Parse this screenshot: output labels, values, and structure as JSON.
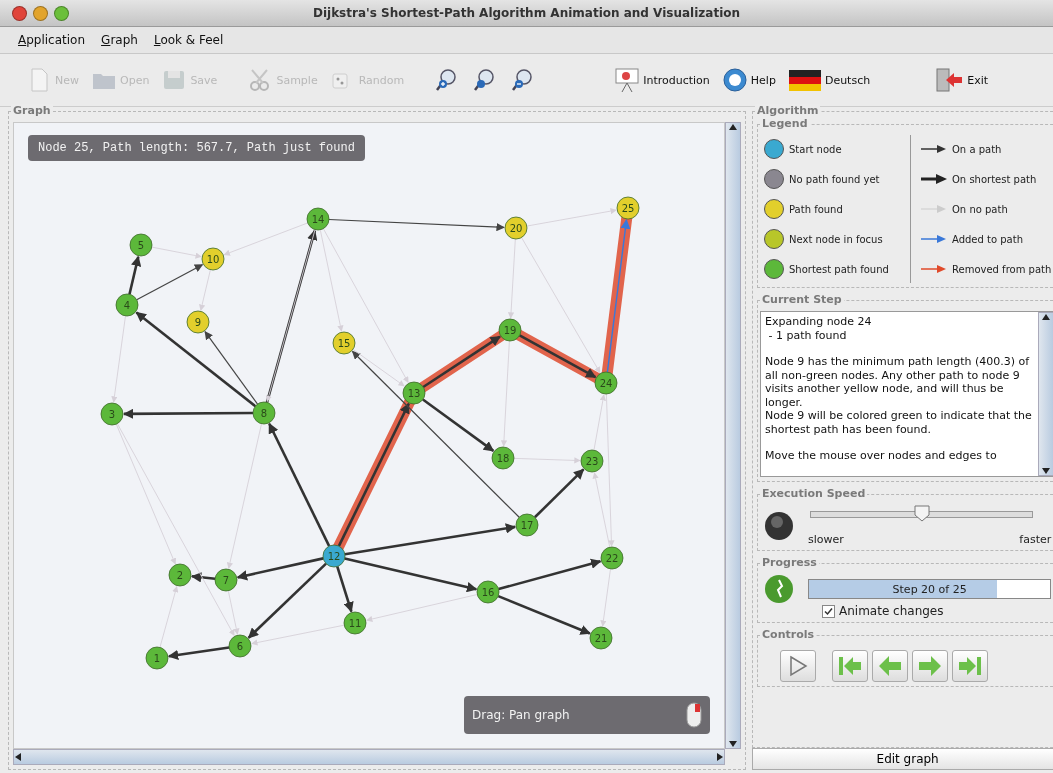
{
  "window": {
    "title": "Dijkstra's Shortest-Path Algorithm Animation and Visualization"
  },
  "menu": [
    {
      "label": "Application"
    },
    {
      "label": "Graph"
    },
    {
      "label": "Look & Feel"
    }
  ],
  "toolbar": [
    {
      "kind": "new",
      "label": "New",
      "disabled": true
    },
    {
      "kind": "open",
      "label": "Open",
      "disabled": true
    },
    {
      "kind": "save",
      "label": "Save",
      "disabled": true
    },
    {
      "kind": "sample",
      "label": "Sample",
      "disabled": true
    },
    {
      "kind": "random",
      "label": "Random",
      "disabled": true
    },
    {
      "kind": "zoom-in",
      "disabled": false
    },
    {
      "kind": "zoom-reset",
      "disabled": false
    },
    {
      "kind": "zoom-out",
      "disabled": false
    },
    {
      "kind": "introduction",
      "label": "Introduction",
      "disabled": false
    },
    {
      "kind": "help",
      "label": "Help",
      "disabled": false
    },
    {
      "kind": "language",
      "label": "Deutsch",
      "disabled": false
    },
    {
      "kind": "exit",
      "label": "Exit",
      "disabled": false
    }
  ],
  "graph": {
    "title": "Graph",
    "status": "Node 25, Path length: 567.7, Path just found",
    "hint": "Drag: Pan graph",
    "nodes": [
      {
        "label": "25",
        "kind": "path"
      },
      {
        "label": "14",
        "kind": "shortest"
      },
      {
        "label": "20",
        "kind": "path"
      },
      {
        "label": "5",
        "kind": "shortest"
      },
      {
        "label": "10",
        "kind": "path"
      },
      {
        "label": "4",
        "kind": "shortest"
      },
      {
        "label": "9",
        "kind": "path"
      },
      {
        "label": "15",
        "kind": "path"
      },
      {
        "label": "19",
        "kind": "shortest"
      },
      {
        "label": "13",
        "kind": "shortest"
      },
      {
        "label": "24",
        "kind": "shortest"
      },
      {
        "label": "3",
        "kind": "shortest"
      },
      {
        "label": "8",
        "kind": "shortest"
      },
      {
        "label": "18",
        "kind": "shortest"
      },
      {
        "label": "23",
        "kind": "shortest"
      },
      {
        "label": "17",
        "kind": "shortest"
      },
      {
        "label": "12",
        "kind": "start"
      },
      {
        "label": "22",
        "kind": "shortest"
      },
      {
        "label": "2",
        "kind": "shortest"
      },
      {
        "label": "7",
        "kind": "shortest"
      },
      {
        "label": "16",
        "kind": "shortest"
      },
      {
        "label": "11",
        "kind": "shortest"
      },
      {
        "label": "6",
        "kind": "shortest"
      },
      {
        "label": "21",
        "kind": "shortest"
      },
      {
        "label": "1",
        "kind": "shortest"
      }
    ],
    "edges": [
      {
        "kind": "shortest",
        "highlighted": true
      },
      {
        "kind": "shortest",
        "highlighted": true
      },
      {
        "kind": "shortest",
        "highlighted": true
      },
      {
        "kind": "added",
        "highlighted": true
      },
      {
        "kind": "shortest",
        "highlighted": false
      },
      {
        "kind": "shortest",
        "highlighted": false
      },
      {
        "kind": "shortest",
        "highlighted": false
      },
      {
        "kind": "shortest",
        "highlighted": false
      },
      {
        "kind": "shortest",
        "highlighted": false
      },
      {
        "kind": "shortest",
        "highlighted": false
      },
      {
        "kind": "shortest",
        "highlighted": false
      },
      {
        "kind": "shortest",
        "highlighted": false
      },
      {
        "kind": "shortest",
        "highlighted": false
      },
      {
        "kind": "shortest",
        "highlighted": false
      },
      {
        "kind": "shortest",
        "highlighted": false
      },
      {
        "kind": "shortest",
        "highlighted": false
      },
      {
        "kind": "shortest",
        "highlighted": false
      },
      {
        "kind": "shortest",
        "highlighted": false
      },
      {
        "kind": "shortest",
        "highlighted": false
      },
      {
        "kind": "shortest",
        "highlighted": false
      },
      {
        "kind": "path",
        "highlighted": false
      },
      {
        "kind": "path",
        "highlighted": false
      },
      {
        "kind": "path",
        "highlighted": false
      },
      {
        "kind": "path",
        "highlighted": false
      },
      {
        "kind": "none",
        "highlighted": false
      },
      {
        "kind": "none",
        "highlighted": false
      },
      {
        "kind": "none",
        "highlighted": false
      },
      {
        "kind": "none",
        "highlighted": false
      },
      {
        "kind": "none",
        "highlighted": false
      },
      {
        "kind": "none",
        "highlighted": false
      },
      {
        "kind": "none",
        "highlighted": false
      },
      {
        "kind": "none",
        "highlighted": false
      },
      {
        "kind": "none",
        "highlighted": false
      },
      {
        "kind": "none",
        "highlighted": false
      },
      {
        "kind": "none",
        "highlighted": false
      },
      {
        "kind": "none",
        "highlighted": false
      },
      {
        "kind": "none",
        "highlighted": false
      },
      {
        "kind": "none",
        "highlighted": false
      },
      {
        "kind": "none",
        "highlighted": false
      },
      {
        "kind": "none",
        "highlighted": false
      },
      {
        "kind": "none",
        "highlighted": false
      },
      {
        "kind": "none",
        "highlighted": false
      },
      {
        "kind": "none",
        "highlighted": false
      },
      {
        "kind": "none",
        "highlighted": false
      },
      {
        "kind": "none",
        "highlighted": false
      },
      {
        "kind": "none",
        "highlighted": false
      },
      {
        "kind": "none",
        "highlighted": false
      },
      {
        "kind": "none",
        "highlighted": false
      }
    ]
  },
  "algorithm": {
    "title": "Algorithm",
    "legend": {
      "title": "Legend",
      "nodes": [
        {
          "label": "Start node",
          "color": "#3aa9d0"
        },
        {
          "label": "No path found yet",
          "color": "#8a8790"
        },
        {
          "label": "Path found",
          "color": "#e2cf2c"
        },
        {
          "label": "Next node in focus",
          "color": "#b8c629"
        },
        {
          "label": "Shortest path found",
          "color": "#5cb83a"
        }
      ],
      "arrows": [
        {
          "label": "On a path",
          "color": "#333333",
          "kind": "thin"
        },
        {
          "label": "On shortest path",
          "color": "#222222",
          "kind": "thick"
        },
        {
          "label": "On no path",
          "color": "#cccccc",
          "kind": "faint"
        },
        {
          "label": "Added to path",
          "color": "#3a78d8",
          "kind": "thin"
        },
        {
          "label": "Removed from path",
          "color": "#e04a2a",
          "kind": "thin"
        }
      ]
    },
    "current_step": {
      "title": "Current Step",
      "paragraphs": [
        "Expanding node 24\n - 1 path found",
        "Node 9 has the minimum path length (400.3) of all non-green nodes. Any other path to node 9 visits another yellow node, and will thus be longer.\nNode 9 will be colored green to indicate that the shortest path has been found.",
        "Move the mouse over nodes and edges to"
      ]
    },
    "speed": {
      "title": "Execution Speed",
      "level": 0.5,
      "slower": "slower",
      "faster": "faster"
    },
    "progress": {
      "title": "Progress",
      "level": 0.78,
      "text": "Step 20 of 25"
    },
    "animate": {
      "label": "Animate changes",
      "checked": true
    },
    "controls": {
      "title": "Controls",
      "buttons": [
        {
          "kind": "play"
        },
        {
          "kind": "first"
        },
        {
          "kind": "previous"
        },
        {
          "kind": "next"
        },
        {
          "kind": "last"
        }
      ]
    },
    "edit_button": "Edit graph"
  }
}
